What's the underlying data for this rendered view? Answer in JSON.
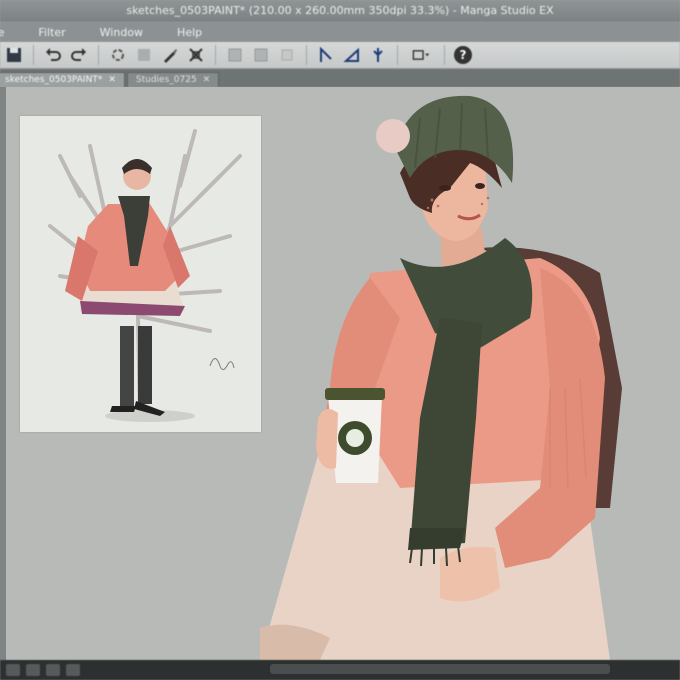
{
  "window": {
    "title": "sketches_0503PAINT* (210.00 x 260.00mm 350dpi 33.3%) - Manga Studio EX"
  },
  "menu": {
    "items": [
      "File",
      "Filter",
      "Window",
      "Help"
    ]
  },
  "toolbar": {
    "icons": [
      "save-icon",
      "undo-icon",
      "redo-icon",
      "transform-icon",
      "rotate-icon",
      "ruler-icon",
      "grid-icon",
      "view-icon",
      "help-icon"
    ],
    "help_label": "?"
  },
  "tabs": [
    {
      "label": "sketches_0503PAINT*",
      "active": true
    },
    {
      "label": "Studies_0725",
      "active": false
    }
  ],
  "colors": {
    "canvas_bg": "#b7bab7",
    "hat": "#4f5a45",
    "sweater": "#e7917f",
    "scarf": "#3f4637",
    "skirt": "#e6cfc3"
  }
}
